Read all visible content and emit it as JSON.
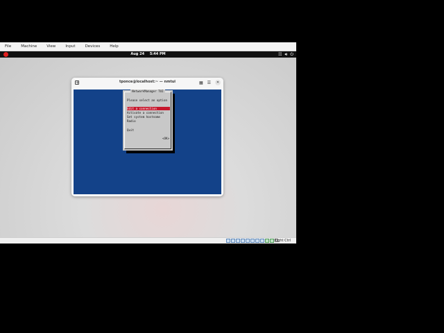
{
  "menubar": {
    "items": [
      "File",
      "Machine",
      "View",
      "Input",
      "Devices",
      "Help"
    ]
  },
  "topbar": {
    "date": "Aug 24",
    "time": "5:44 PM",
    "tray": [
      "network-icon",
      "volume-icon",
      "power-icon"
    ]
  },
  "terminal": {
    "title": "tponce@localhost:~ — nmtui"
  },
  "nmtui": {
    "title": "NetworkManager TUI",
    "prompt": "Please select an option",
    "options": [
      "Edit a connection",
      "Activate a connection",
      "Set system hostname",
      "Radio"
    ],
    "selected_index": 0,
    "quit": "Quit",
    "ok": "<OK>"
  },
  "statusbar": {
    "host_key": "Right Ctrl"
  },
  "colors": {
    "terminal_bg": "#134289",
    "selection": "#c6182d",
    "dialog_bg": "#c8c8c8"
  }
}
